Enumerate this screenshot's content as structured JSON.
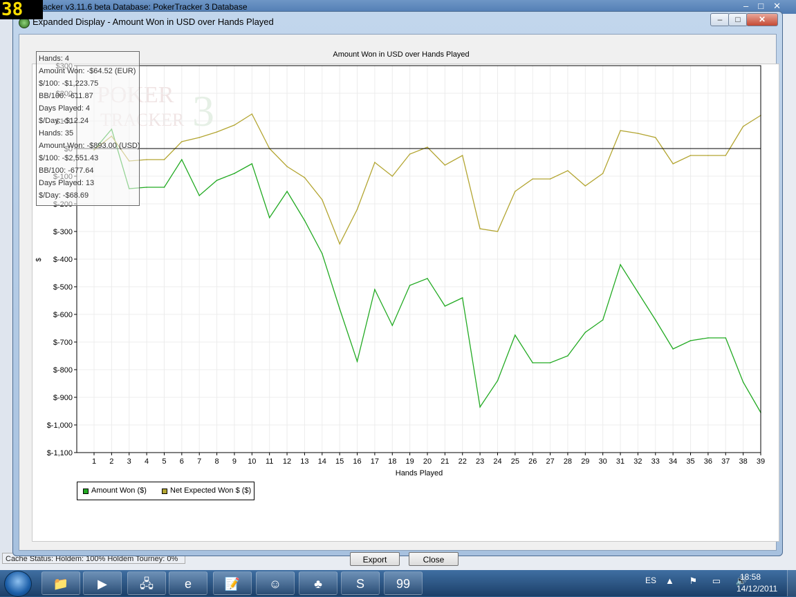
{
  "background_window": {
    "title": "racker v3.11.6 beta   Database: PokerTracker 3 Database",
    "fps_overlay": "38",
    "status_text": "Cache Status: Holdem: 100%   Holdem Tourney: 0%"
  },
  "dialog": {
    "title": "Expanded Display - Amount Won in USD over Hands Played",
    "export_label": "Export",
    "close_label": "Close",
    "min_glyph": "–",
    "max_glyph": "□",
    "close_glyph": "✕"
  },
  "tooltip": {
    "lines": [
      "Hands: 4",
      "Amount Won: -$64.52 (EUR)",
      "$/100: -$1,223.75",
      "BB/100: -611.87",
      "Days Played: 4",
      "$/Day: -$12.24",
      "Hands: 35",
      "Amount Won: -$893.00 (USD)",
      "$/100: -$2,551.43",
      "BB/100: -677.64",
      "Days Played: 13",
      "$/Day: -$68.69"
    ]
  },
  "watermark": {
    "line1": "POKER",
    "line2": "TRACKER",
    "digit": "3"
  },
  "chart_data": {
    "type": "line",
    "title": "Amount Won in USD over Hands Played",
    "xlabel": "Hands Played",
    "ylabel": "$",
    "x": [
      1,
      2,
      3,
      4,
      5,
      6,
      7,
      8,
      9,
      10,
      11,
      12,
      13,
      14,
      15,
      16,
      17,
      18,
      19,
      20,
      21,
      22,
      23,
      24,
      25,
      26,
      27,
      28,
      29,
      30,
      31,
      32,
      33,
      34,
      35,
      36,
      37,
      38,
      39
    ],
    "ylim": [
      -1100,
      300
    ],
    "yticks": [
      300,
      200,
      100,
      0,
      -100,
      -200,
      -300,
      -400,
      -500,
      -600,
      -700,
      -800,
      -900,
      -1000,
      -1100
    ],
    "ytick_labels": [
      "$300",
      "$200",
      "$100",
      "$0",
      "$-100",
      "$-200",
      "$-300",
      "$-400",
      "$-500",
      "$-600",
      "$-700",
      "$-800",
      "$-900",
      "$-1,000",
      "$-1,100"
    ],
    "series": [
      {
        "name": "Amount Won ($)",
        "color": "#22aa22",
        "values": [
          -5,
          70,
          -145,
          -140,
          -140,
          -40,
          -170,
          -115,
          -90,
          -55,
          -250,
          -155,
          -260,
          -380,
          -580,
          -770,
          -510,
          -640,
          -495,
          -470,
          -570,
          -540,
          -935,
          -840,
          -675,
          -775,
          -775,
          -750,
          -665,
          -620,
          -420,
          -520,
          -620,
          -725,
          -695,
          -685,
          -685,
          -845,
          -955
        ]
      },
      {
        "name": "Net Expected Won $ ($)",
        "color": "#b3a531",
        "values": [
          -5,
          45,
          -45,
          -40,
          -40,
          25,
          40,
          60,
          85,
          125,
          0,
          -65,
          -105,
          -185,
          -345,
          -220,
          -50,
          -100,
          -20,
          5,
          -60,
          -25,
          -290,
          -300,
          -155,
          -110,
          -110,
          -80,
          -135,
          -90,
          65,
          55,
          40,
          -55,
          -25,
          -25,
          -25,
          80,
          120
        ]
      }
    ],
    "grid": true,
    "legend_position": "bottom-left"
  },
  "taskbar": {
    "items": [
      {
        "name": "explorer",
        "glyph": "📁"
      },
      {
        "name": "media-player",
        "glyph": "▶"
      },
      {
        "name": "network",
        "glyph": "🖧"
      },
      {
        "name": "internet-explorer",
        "glyph": "e"
      },
      {
        "name": "notes",
        "glyph": "📝"
      },
      {
        "name": "messenger",
        "glyph": "☺"
      },
      {
        "name": "pokertracker",
        "glyph": "♣"
      },
      {
        "name": "skype",
        "glyph": "S"
      },
      {
        "name": "fraps",
        "glyph": "99"
      }
    ],
    "lang": "ES",
    "tray": "▲ ⚑ ▭ 🔊",
    "time": "18:58",
    "date": "14/12/2011"
  }
}
